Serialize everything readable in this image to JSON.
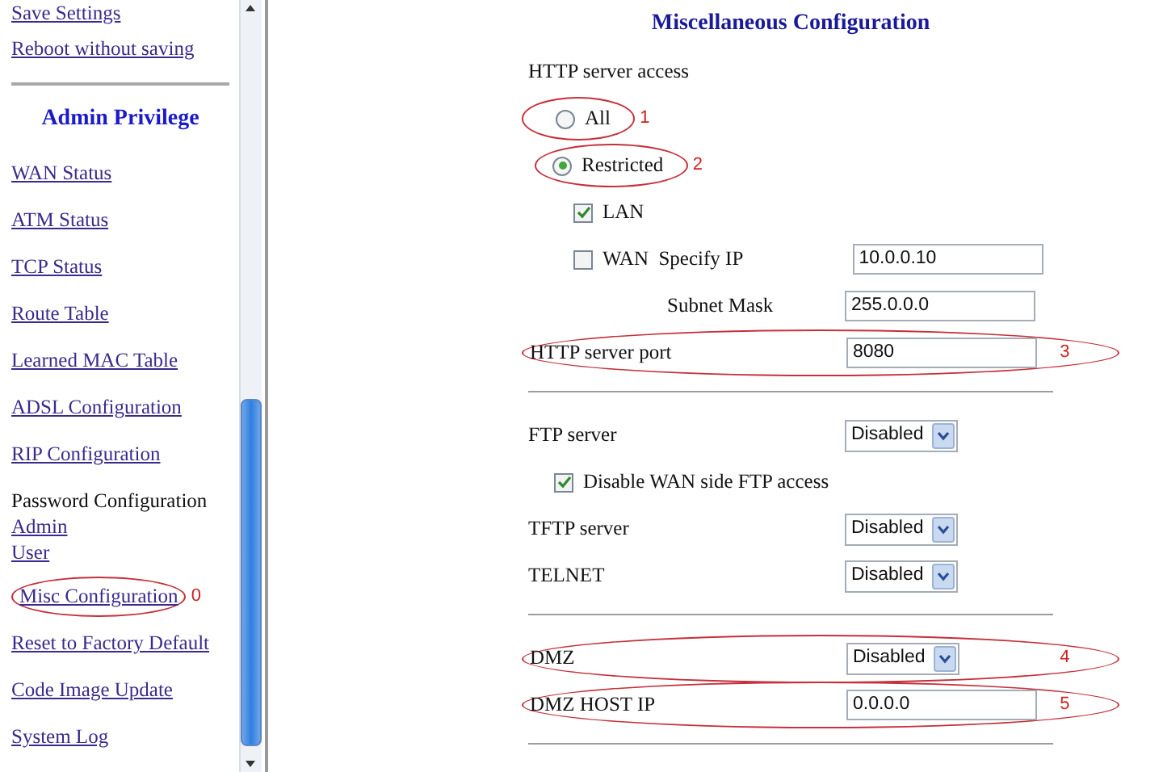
{
  "sidebar": {
    "items": [
      {
        "kind": "link",
        "label": "Save Settings"
      },
      {
        "kind": "link",
        "label": "Reboot without saving"
      },
      {
        "kind": "divider"
      },
      {
        "kind": "heading",
        "label": "Admin Privilege"
      },
      {
        "kind": "link",
        "label": "WAN Status"
      },
      {
        "kind": "link",
        "label": "ATM Status"
      },
      {
        "kind": "link",
        "label": "TCP Status"
      },
      {
        "kind": "link",
        "label": "Route Table"
      },
      {
        "kind": "link",
        "label": "Learned MAC Table"
      },
      {
        "kind": "link",
        "label": "ADSL Configuration"
      },
      {
        "kind": "link",
        "label": "RIP Configuration"
      },
      {
        "kind": "group",
        "label": "Password Configuration",
        "children": [
          {
            "label": "Admin"
          },
          {
            "label": "User"
          }
        ]
      },
      {
        "kind": "link",
        "label": "Misc Configuration",
        "callout": "0"
      },
      {
        "kind": "link",
        "label": "Reset to Factory Default"
      },
      {
        "kind": "link",
        "label": "Code Image Update"
      },
      {
        "kind": "link",
        "label": "System Log"
      }
    ]
  },
  "main": {
    "title": "Miscellaneous Configuration",
    "rows": [
      {
        "kind": "label",
        "label": "HTTP server access"
      },
      {
        "kind": "radio",
        "label": "All",
        "selected": false,
        "callout": "1"
      },
      {
        "kind": "radio",
        "label": "Restricted",
        "selected": true,
        "callout": "2"
      },
      {
        "kind": "checkbox",
        "label": "LAN",
        "checked": true
      },
      {
        "kind": "checkbox",
        "label": "WAN",
        "checked": false,
        "field_label": "Specify IP",
        "value": "10.0.0.10"
      },
      {
        "kind": "subinput",
        "label": "Subnet Mask",
        "value": "255.0.0.0"
      },
      {
        "kind": "input",
        "label": "HTTP server port",
        "value": "8080",
        "callout": "3"
      },
      {
        "kind": "divider"
      },
      {
        "kind": "select",
        "label": "FTP server",
        "value": "Disabled"
      },
      {
        "kind": "option",
        "label": "Disable WAN side FTP access",
        "checked": true
      },
      {
        "kind": "select",
        "label": "TFTP server",
        "value": "Disabled"
      },
      {
        "kind": "select",
        "label": "TELNET",
        "value": "Disabled"
      },
      {
        "kind": "divider"
      },
      {
        "kind": "select",
        "label": "DMZ",
        "value": "Disabled",
        "callout": "4"
      },
      {
        "kind": "input",
        "label": "DMZ HOST IP",
        "value": "0.0.0.0",
        "callout": "5"
      },
      {
        "kind": "divider"
      }
    ]
  }
}
